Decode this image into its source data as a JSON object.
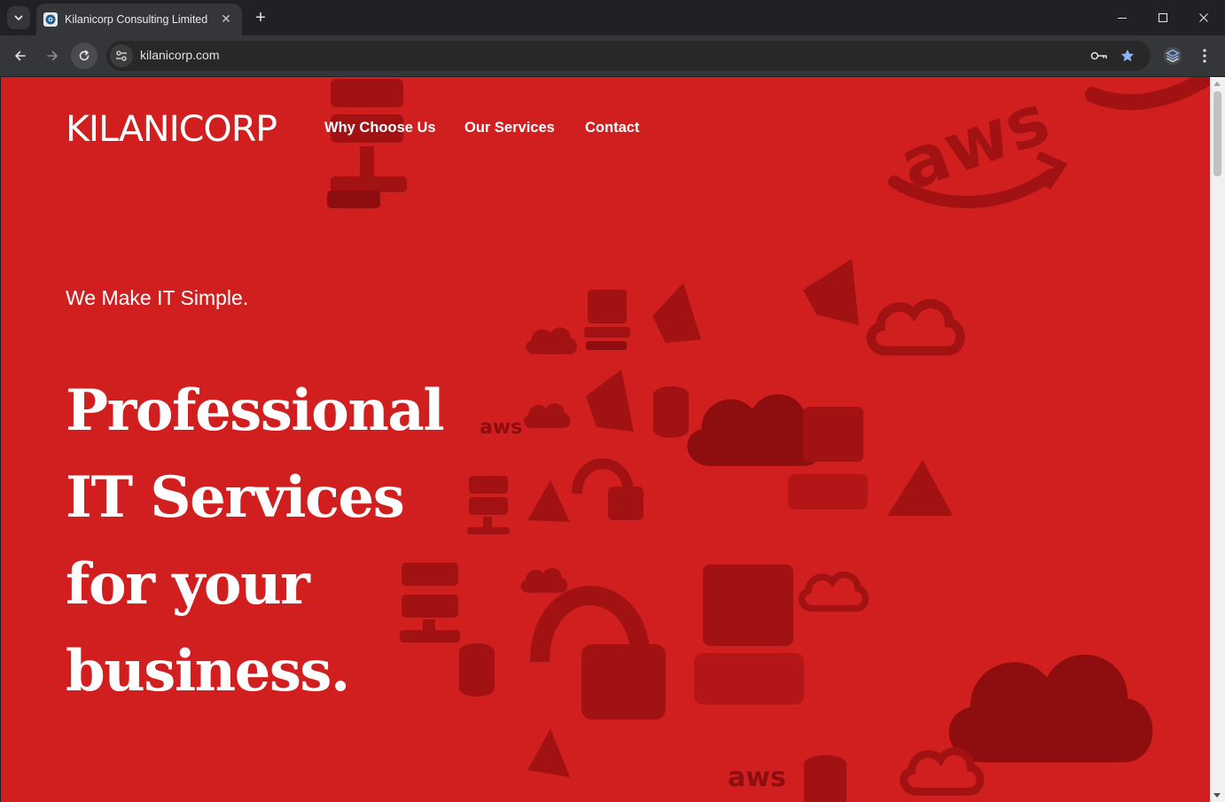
{
  "browser": {
    "tab": {
      "title": "Kilanicorp Consulting Limited"
    },
    "url": "kilanicorp.com"
  },
  "site": {
    "logo_text": "KILANICORP",
    "nav": [
      "Why Choose Us",
      "Our Services",
      "Contact"
    ],
    "tagline": "We Make IT Simple.",
    "headline_lines": [
      "Professional",
      "IT Services",
      "for your",
      "business."
    ],
    "decor_badge_text": "aws"
  },
  "colors": {
    "background": "#d11f20",
    "decor_dark": "#8e0e0f",
    "decor_mid": "#b41516",
    "text": "#ffffff"
  },
  "icons": {
    "decor": [
      "aws-logo-icon",
      "cloud-icon",
      "server-icon",
      "database-icon",
      "lock-icon",
      "monitor-icon",
      "azure-icon",
      "vscode-icon"
    ]
  }
}
